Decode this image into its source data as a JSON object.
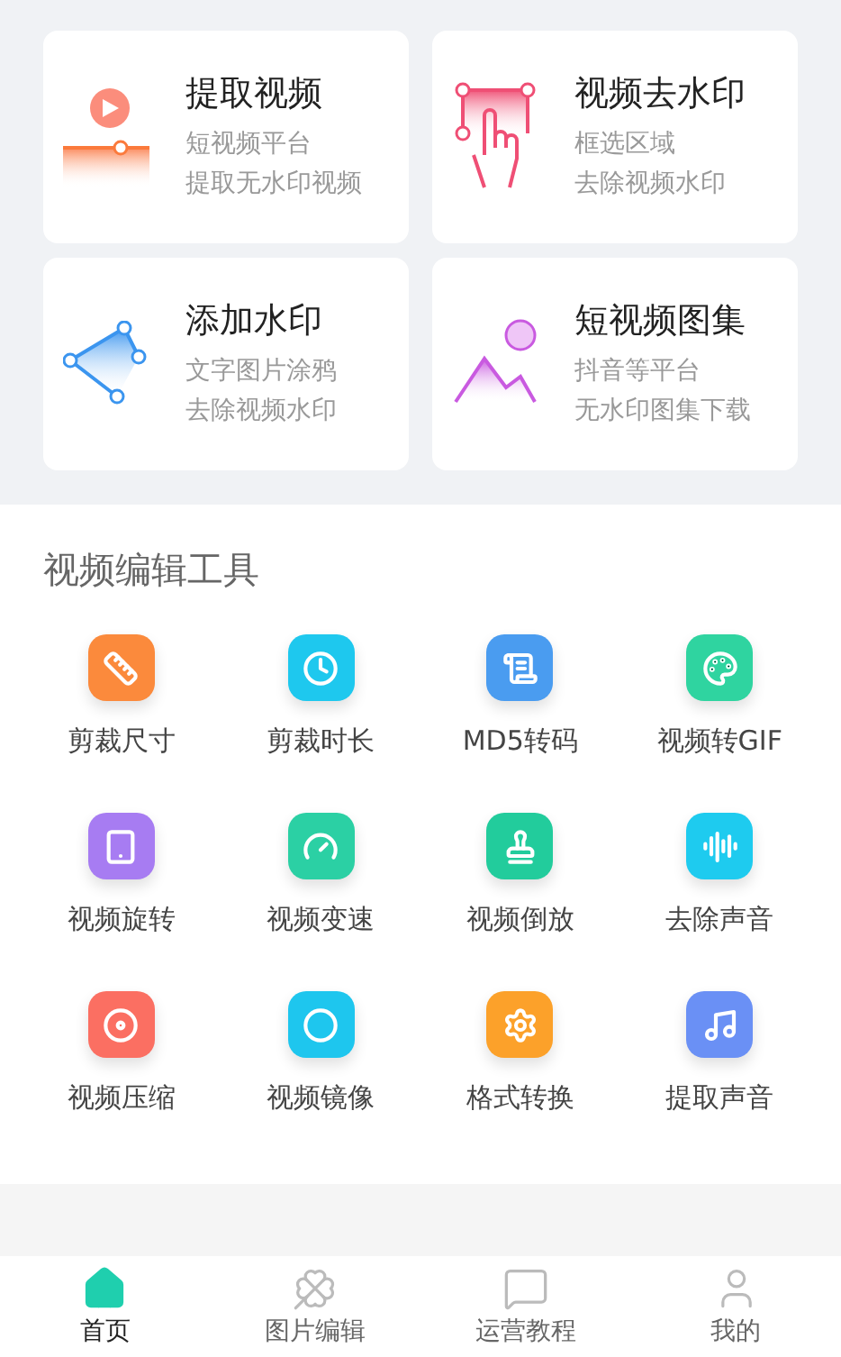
{
  "features": [
    {
      "title": "提取视频",
      "lines": [
        "短视频平台",
        "提取无水印视频"
      ]
    },
    {
      "title": "视频去水印",
      "lines": [
        "框选区域",
        "去除视频水印"
      ]
    },
    {
      "title": "添加水印",
      "lines": [
        "文字图片涂鸦",
        "去除视频水印"
      ]
    },
    {
      "title": "短视频图集",
      "lines": [
        "抖音等平台",
        "无水印图集下载"
      ]
    }
  ],
  "section_title": "视频编辑工具",
  "tools": [
    {
      "label": "剪裁尺寸",
      "color": "#fb8a3c"
    },
    {
      "label": "剪裁时长",
      "color": "#1ec8ee"
    },
    {
      "label": "MD5转码",
      "color": "#4a9cf0"
    },
    {
      "label": "视频转GIF",
      "color": "#2fd4a0"
    },
    {
      "label": "视频旋转",
      "color": "#a77cf2"
    },
    {
      "label": "视频变速",
      "color": "#2bd0a4"
    },
    {
      "label": "视频倒放",
      "color": "#22cc9c"
    },
    {
      "label": "去除声音",
      "color": "#1ecbef"
    },
    {
      "label": "视频压缩",
      "color": "#fb6f62"
    },
    {
      "label": "视频镜像",
      "color": "#1ec6ee"
    },
    {
      "label": "格式转换",
      "color": "#fca12a"
    },
    {
      "label": "提取声音",
      "color": "#6a90f5"
    }
  ],
  "tabs": [
    {
      "label": "首页",
      "selected": true
    },
    {
      "label": "图片编辑",
      "selected": false
    },
    {
      "label": "运营教程",
      "selected": false
    },
    {
      "label": "我的",
      "selected": false
    }
  ]
}
